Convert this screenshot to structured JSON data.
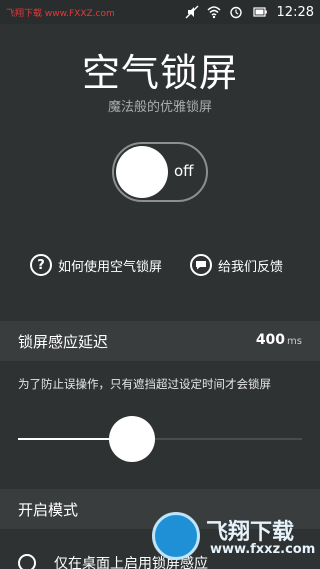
{
  "statusbar": {
    "watermark": "飞翔下载 www.FXXZ.com",
    "time": "12:28",
    "icons": [
      "mute-icon",
      "wifi-icon",
      "alarm-icon",
      "battery-icon"
    ]
  },
  "header": {
    "title": "空气锁屏",
    "subtitle": "魔法般的优雅锁屏"
  },
  "toggle": {
    "label": "off",
    "state": "off"
  },
  "links": {
    "help_label": "如何使用空气锁屏",
    "help_icon_glyph": "?",
    "feedback_label": "给我们反馈"
  },
  "delay_section": {
    "title": "锁屏感应延迟",
    "value": "400",
    "unit": "ms",
    "description": "为了防止误操作，只有遮挡超过设定时间才会锁屏",
    "slider_fraction": 0.4
  },
  "mode_section": {
    "title": "开启模式",
    "option_label": "仅在桌面上启用锁屏感应"
  },
  "watermark": {
    "text": "飞翔下载",
    "url": "www.fxxz.com"
  },
  "colors": {
    "background": "#2f3233",
    "section": "#3a3d3e",
    "accent": "#ffffff"
  }
}
